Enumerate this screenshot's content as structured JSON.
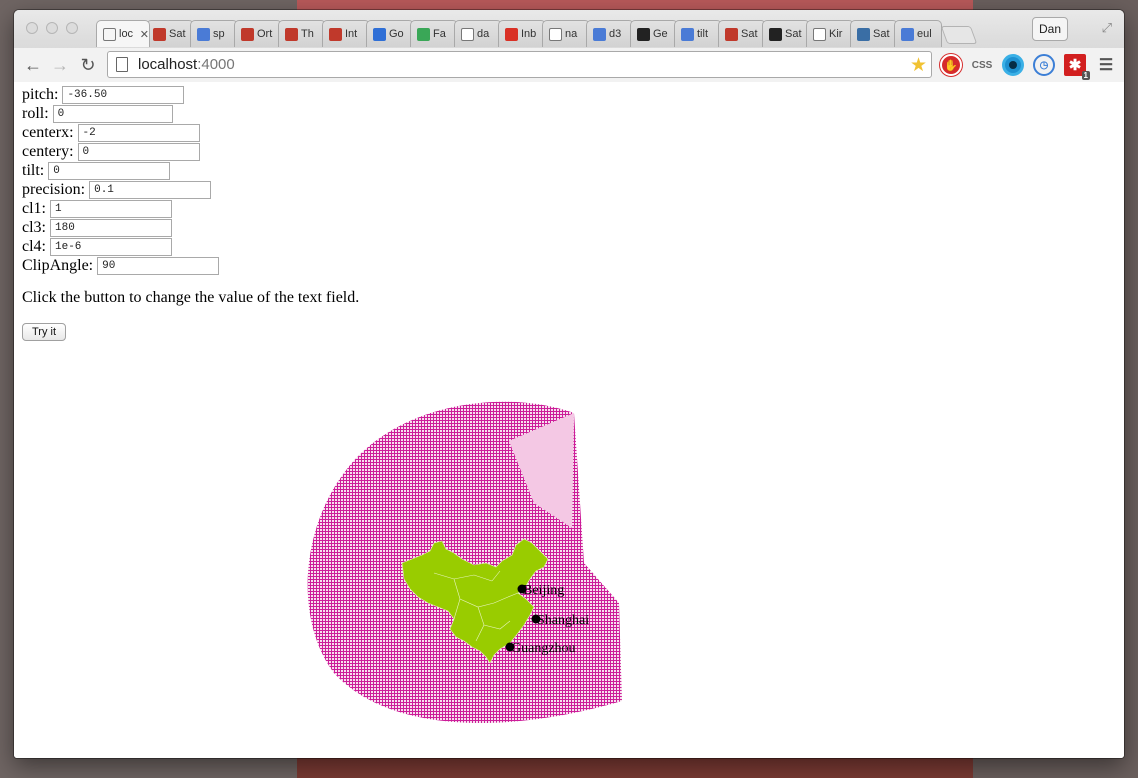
{
  "browser": {
    "tabs": [
      {
        "label": "loc",
        "icon": "page-icon",
        "color": "#f6f6f6",
        "active": true
      },
      {
        "label": "Sat",
        "icon": "cube-icon",
        "color": "#c0392b"
      },
      {
        "label": "sp",
        "icon": "google-icon",
        "color": "#4a7bd6"
      },
      {
        "label": "Ort",
        "icon": "cube-icon",
        "color": "#c0392b"
      },
      {
        "label": "Th",
        "icon": "cube-icon",
        "color": "#c0392b"
      },
      {
        "label": "Int",
        "icon": "cube-icon",
        "color": "#c0392b"
      },
      {
        "label": "Go",
        "icon": "calendar-icon",
        "color": "#2f6fd6"
      },
      {
        "label": "Fa",
        "icon": "maps-icon",
        "color": "#3aa757"
      },
      {
        "label": "da",
        "icon": "page-icon",
        "color": "#ffffff"
      },
      {
        "label": "Inb",
        "icon": "gmail-icon",
        "color": "#d93025"
      },
      {
        "label": "na",
        "icon": "wikipedia-icon",
        "color": "#ffffff"
      },
      {
        "label": "d3",
        "icon": "google-icon",
        "color": "#4a7bd6"
      },
      {
        "label": "Ge",
        "icon": "github-icon",
        "color": "#222222"
      },
      {
        "label": "tilt",
        "icon": "google-icon",
        "color": "#4a7bd6"
      },
      {
        "label": "Sat",
        "icon": "cube-icon",
        "color": "#c0392b"
      },
      {
        "label": "Sat",
        "icon": "github-icon",
        "color": "#222222"
      },
      {
        "label": "Kir",
        "icon": "page-icon",
        "color": "#ffffff"
      },
      {
        "label": "Sat",
        "icon": "gb-icon",
        "color": "#3a6ea5"
      },
      {
        "label": "eul",
        "icon": "google-icon",
        "color": "#4a7bd6"
      }
    ],
    "profile_name": "Dan",
    "url_host": "localhost",
    "url_port": ":4000",
    "extensions": [
      "adblock-icon",
      "css-icon",
      "eye-icon",
      "clock-icon",
      "lastpass-icon",
      "menu-icon"
    ],
    "ext_css_label": "CSS",
    "ext_badge": "1"
  },
  "form": {
    "fields": [
      {
        "label": "pitch:",
        "value": "-36.50"
      },
      {
        "label": "roll:",
        "value": "0"
      },
      {
        "label": "centerx:",
        "value": "-2"
      },
      {
        "label": "centery:",
        "value": "0"
      },
      {
        "label": "tilt:",
        "value": "0"
      },
      {
        "label": "precision:",
        "value": "0.1"
      },
      {
        "label": "cl1:",
        "value": "1"
      },
      {
        "label": "cl3:",
        "value": "180"
      },
      {
        "label": "cl4:",
        "value": "1e-6"
      },
      {
        "label": "ClipAngle:",
        "value": "90"
      }
    ],
    "instruction": "Click the button to change the value of the text field.",
    "button_label": "Try it"
  },
  "map": {
    "graticule_color": "#cc1d99",
    "land_color": "#99cc00",
    "cities": [
      {
        "name": "Beijing"
      },
      {
        "name": "Shanghai"
      },
      {
        "name": "Guangzhou"
      }
    ]
  }
}
